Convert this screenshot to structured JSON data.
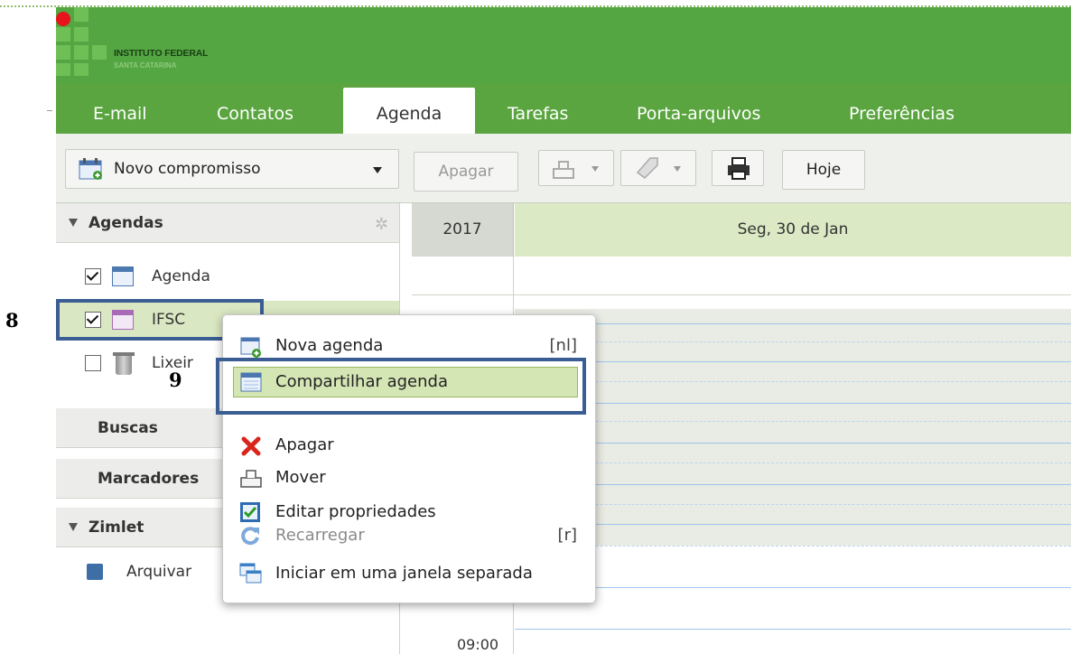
{
  "callouts": {
    "left": "8",
    "menu": "9"
  },
  "header": {
    "org_name": "INSTITUTO FEDERAL",
    "org_sub": "SANTA CATARINA"
  },
  "nav": {
    "tabs": [
      {
        "label": "E-mail"
      },
      {
        "label": "Contatos"
      },
      {
        "label": "Agenda"
      },
      {
        "label": "Tarefas"
      },
      {
        "label": "Porta-arquivos"
      },
      {
        "label": "Preferências"
      }
    ],
    "active": "Agenda"
  },
  "toolbar": {
    "new_appointment": "Novo compromisso",
    "delete": "Apagar",
    "today": "Hoje"
  },
  "sidebar": {
    "agendas_header": "Agendas",
    "agendas": [
      {
        "label": "Agenda",
        "checked": true
      },
      {
        "label": "IFSC",
        "checked": true
      },
      {
        "label": "Lixeir",
        "checked": false
      }
    ],
    "searches_header": "Buscas",
    "tags_header": "Marcadores",
    "zimlet_header": "Zimlet",
    "zimlet_items": [
      {
        "label": "Arquivar"
      }
    ]
  },
  "calendar": {
    "year": "2017",
    "day_header": "Seg, 30 de Jan",
    "time_label": "09:00"
  },
  "context_menu": {
    "items": [
      {
        "label": "Nova agenda",
        "shortcut": "[nl]",
        "icon": "new-calendar-icon"
      },
      {
        "label": "Compartilhar agenda",
        "shortcut": "",
        "icon": "share-calendar-icon",
        "selected": true
      },
      {
        "label": "Apagar",
        "shortcut": "",
        "icon": "delete-x-icon"
      },
      {
        "label": "Mover",
        "shortcut": "",
        "icon": "move-icon"
      },
      {
        "label": "Editar propriedades",
        "shortcut": "",
        "icon": "edit-properties-icon"
      },
      {
        "label": "Recarregar",
        "shortcut": "[r]",
        "icon": "reload-icon",
        "disabled": true
      },
      {
        "label": "Iniciar em uma janela separada",
        "shortcut": "",
        "icon": "new-window-icon"
      }
    ]
  },
  "colors": {
    "header_green": "#54a643",
    "nav_green": "#5aa53f",
    "highlight_blue": "#3a5d93",
    "selected_green": "#d5e6b5"
  }
}
